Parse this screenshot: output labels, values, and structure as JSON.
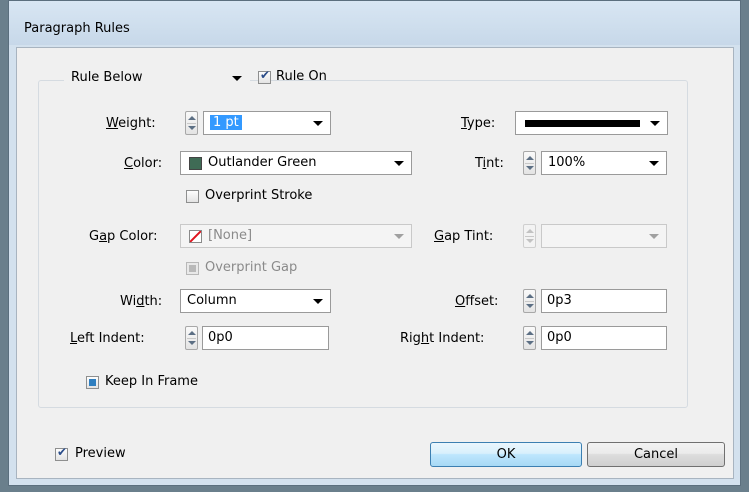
{
  "window": {
    "title": "Paragraph Rules"
  },
  "rule_select": {
    "value": "Rule Below"
  },
  "rule_on": {
    "label": "Rule On",
    "checked": true
  },
  "weight": {
    "label": "Weight:",
    "value": "1 pt"
  },
  "type": {
    "label": "Type:",
    "value_icon": "solid-line"
  },
  "color": {
    "label": "Color:",
    "value": "Outlander Green",
    "swatch": "#3f6b55"
  },
  "tint": {
    "label": "Tint:",
    "value": "100%"
  },
  "overprint_stroke": {
    "label": "Overprint Stroke",
    "checked": false
  },
  "gap_color": {
    "label": "Gap Color:",
    "value": "[None]",
    "swatch_icon": "none-swatch-icon"
  },
  "gap_tint": {
    "label": "Gap Tint:",
    "value": ""
  },
  "overprint_gap": {
    "label": "Overprint Gap",
    "checked": false
  },
  "width": {
    "label": "Width:",
    "value": "Column"
  },
  "offset": {
    "label": "Offset:",
    "value": "0p3"
  },
  "left_indent": {
    "label": "Left Indent:",
    "value": "0p0"
  },
  "right_indent": {
    "label": "Right Indent:",
    "value": "0p0"
  },
  "keep_in_frame": {
    "label": "Keep In Frame",
    "checked": true
  },
  "preview": {
    "label": "Preview",
    "checked": true
  },
  "buttons": {
    "ok": "OK",
    "cancel": "Cancel"
  },
  "colors": {
    "accent": "#3c7fb1",
    "none_slash": "#e0141e"
  }
}
